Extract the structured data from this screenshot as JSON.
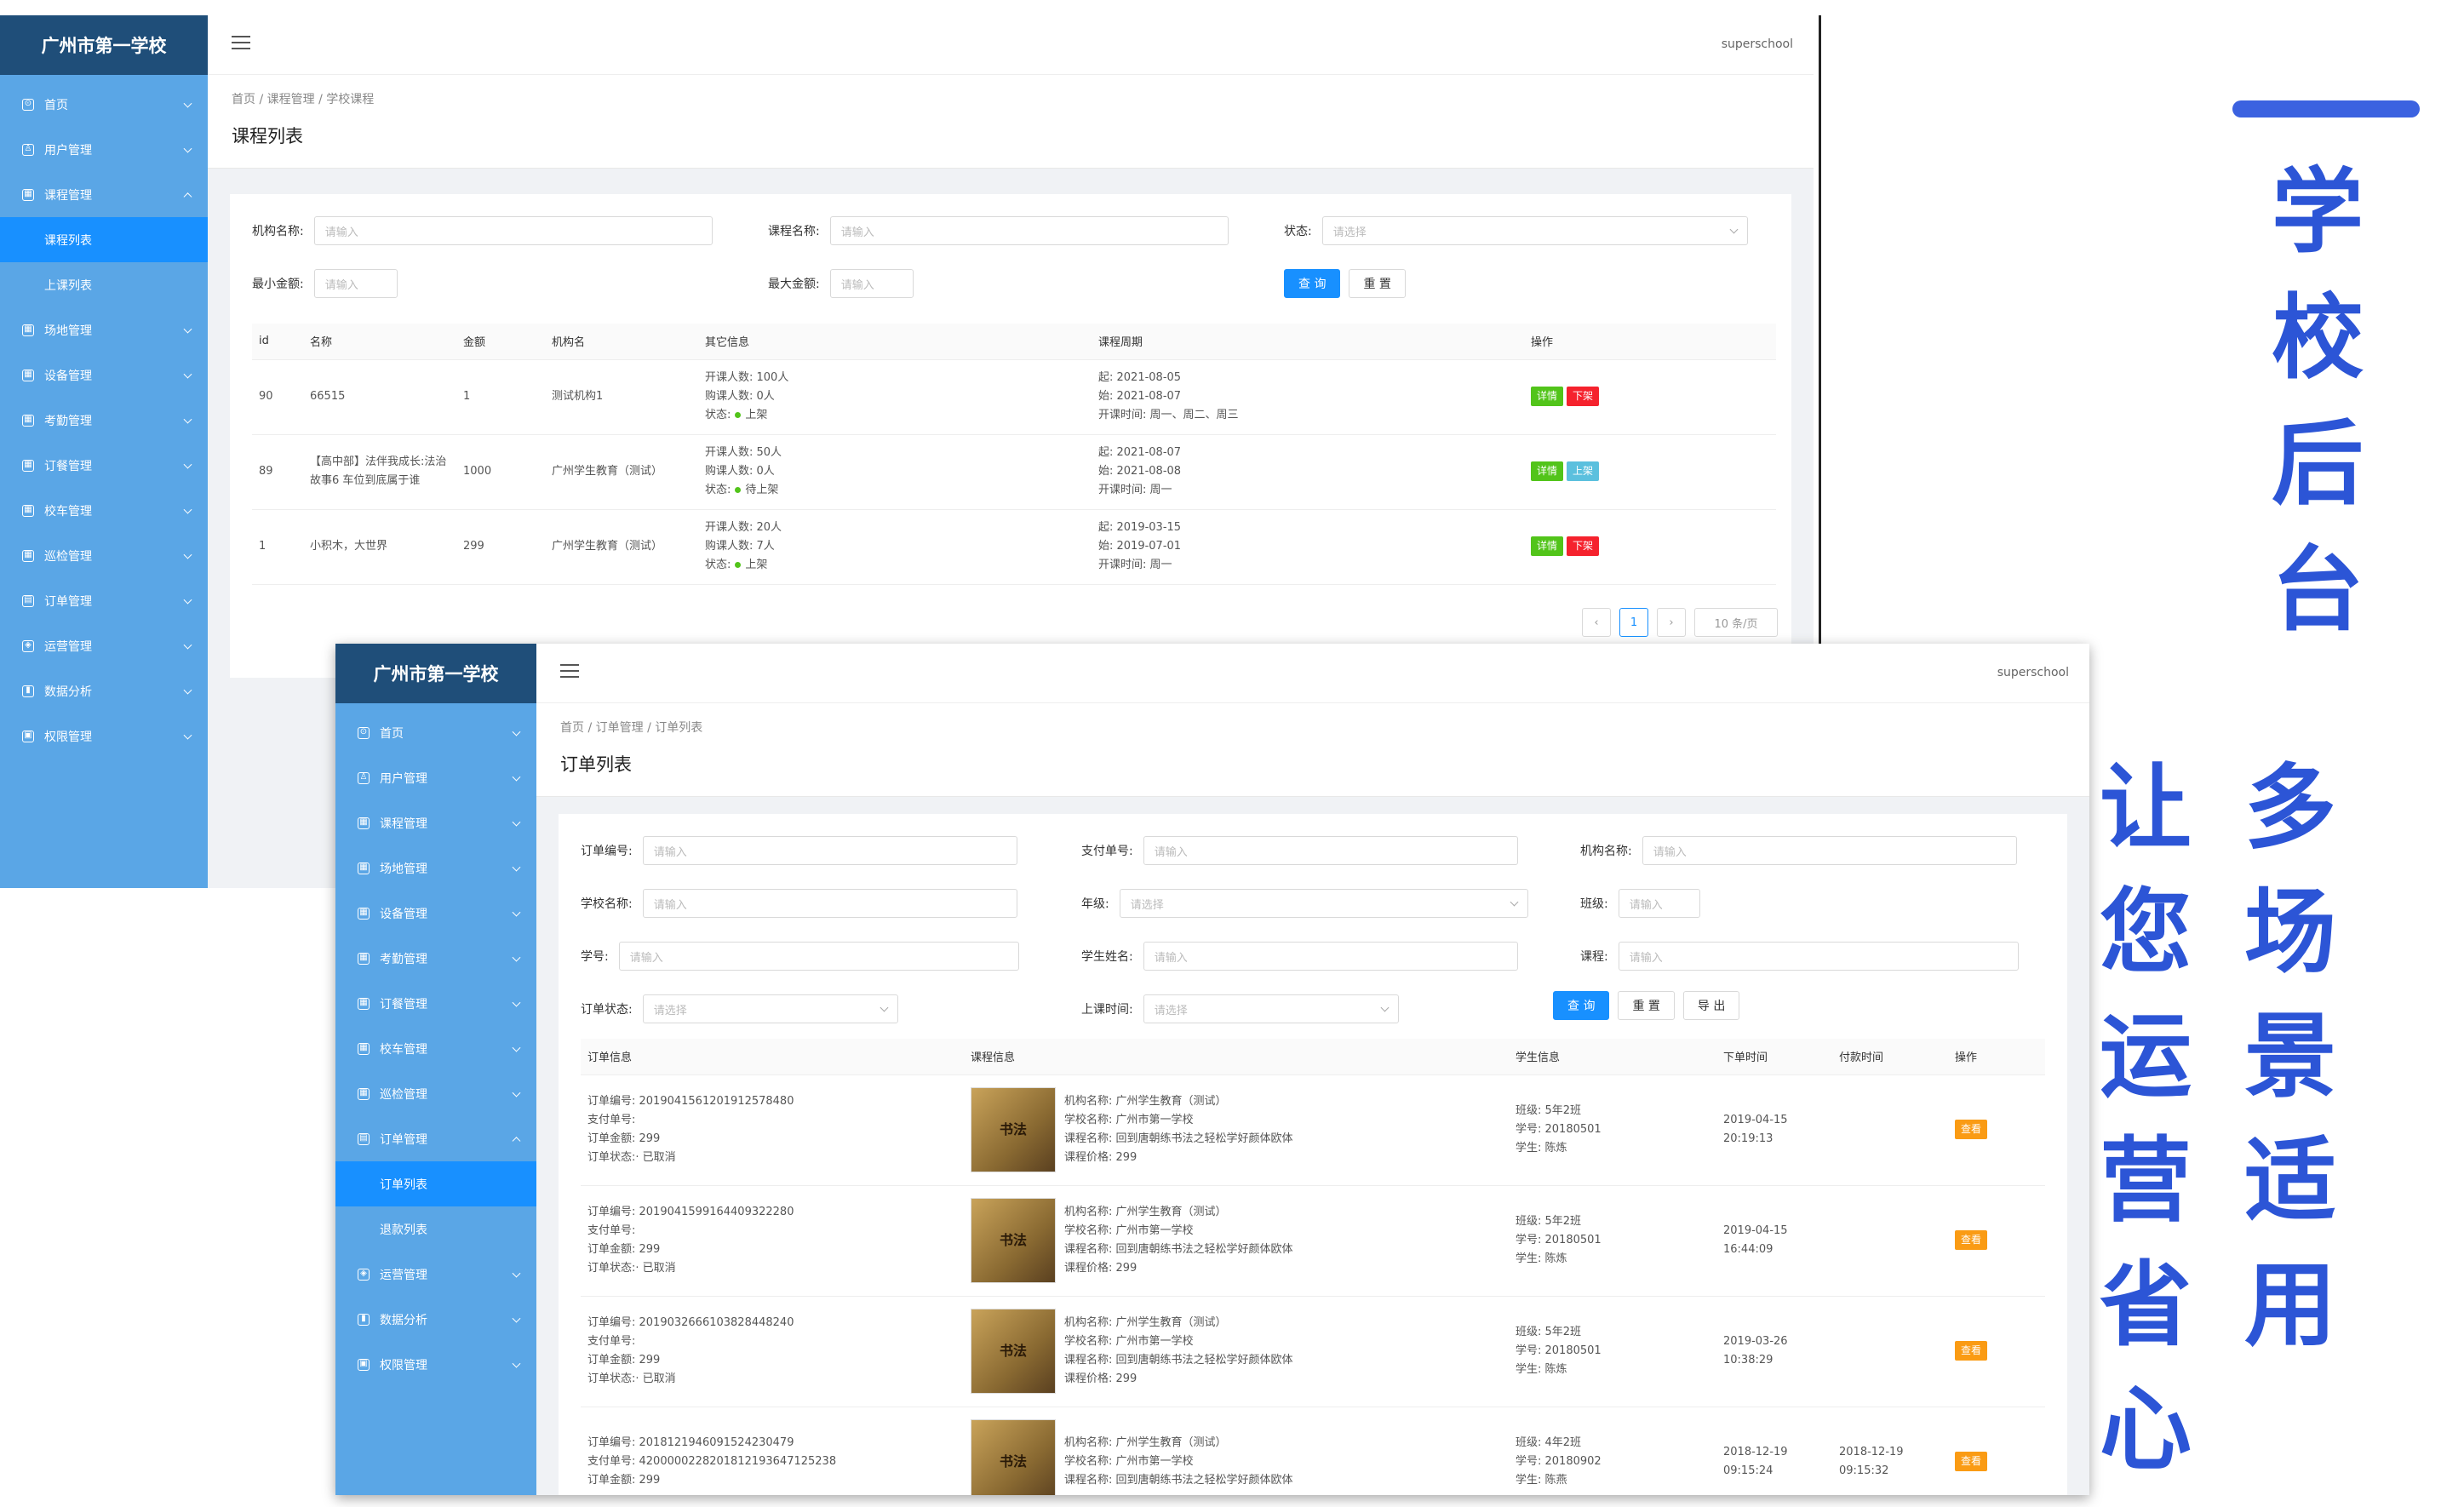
{
  "headline": {
    "main": [
      "学",
      "校",
      "后",
      "台"
    ],
    "col1": [
      "多",
      "场",
      "景",
      "适",
      "用"
    ],
    "col2": [
      "让",
      "您",
      "运",
      "营",
      "省",
      "心"
    ]
  },
  "app": {
    "school": "广州市第一学校",
    "user": "superschool"
  },
  "shot1": {
    "menu": [
      {
        "label": "首页",
        "icon": "⊙"
      },
      {
        "label": "用户管理",
        "icon": "♙"
      },
      {
        "label": "课程管理",
        "icon": "▦",
        "expanded": true
      },
      {
        "label": "场地管理",
        "icon": "▦"
      },
      {
        "label": "设备管理",
        "icon": "▦"
      },
      {
        "label": "考勤管理",
        "icon": "▦"
      },
      {
        "label": "订餐管理",
        "icon": "▦"
      },
      {
        "label": "校车管理",
        "icon": "▦"
      },
      {
        "label": "巡检管理",
        "icon": "▦"
      },
      {
        "label": "订单管理",
        "icon": "▤"
      },
      {
        "label": "运营管理",
        "icon": "◈"
      },
      {
        "label": "数据分析",
        "icon": "▮"
      },
      {
        "label": "权限管理",
        "icon": "▣"
      }
    ],
    "submenu": [
      "课程列表",
      "上课列表"
    ],
    "breadcrumb": "首页 / 课程管理 / 学校课程",
    "title": "课程列表",
    "filters": {
      "org_label": "机构名称:",
      "org_ph": "请输入",
      "course_label": "课程名称:",
      "course_ph": "请输入",
      "status_label": "状态:",
      "status_ph": "请选择",
      "min_label": "最小金额:",
      "min_ph": "请输入",
      "max_label": "最大金额:",
      "max_ph": "请输入",
      "query": "查 询",
      "reset": "重 置"
    },
    "columns": [
      "id",
      "名称",
      "金额",
      "机构名",
      "其它信息",
      "课程周期",
      "操作"
    ],
    "rows": [
      {
        "id": "90",
        "name": "66515",
        "amount": "1",
        "org": "测试机构1",
        "info": [
          "开课人数: 100人",
          "购课人数: 0人",
          "状态:"
        ],
        "status": "上架",
        "period": [
          "起: 2021-08-05",
          "始: 2021-08-07",
          "开课时间: 周一、周二、周三"
        ],
        "actions": [
          "详情",
          "下架"
        ]
      },
      {
        "id": "89",
        "name": "【高中部】法伴我成长:法治故事6 车位到底属于谁",
        "amount": "1000",
        "org": "广州学生教育（测试）",
        "info": [
          "开课人数: 50人",
          "购课人数: 0人",
          "状态:"
        ],
        "status": "待上架",
        "period": [
          "起: 2021-08-07",
          "始: 2021-08-08",
          "开课时间: 周一"
        ],
        "actions": [
          "详情",
          "上架"
        ]
      },
      {
        "id": "1",
        "name": "小积木，大世界",
        "amount": "299",
        "org": "广州学生教育（测试）",
        "info": [
          "开课人数: 20人",
          "购课人数: 7人",
          "状态:"
        ],
        "status": "上架",
        "period": [
          "起: 2019-03-15",
          "始: 2019-07-01",
          "开课时间: 周一"
        ],
        "actions": [
          "详情",
          "下架"
        ]
      }
    ],
    "pager": {
      "prev": "‹",
      "page": "1",
      "next": "›",
      "size": "10 条/页"
    }
  },
  "shot2": {
    "menu": [
      {
        "label": "首页",
        "icon": "⊙"
      },
      {
        "label": "用户管理",
        "icon": "♙"
      },
      {
        "label": "课程管理",
        "icon": "▦"
      },
      {
        "label": "场地管理",
        "icon": "▦"
      },
      {
        "label": "设备管理",
        "icon": "▦"
      },
      {
        "label": "考勤管理",
        "icon": "▦"
      },
      {
        "label": "订餐管理",
        "icon": "▦"
      },
      {
        "label": "校车管理",
        "icon": "▦"
      },
      {
        "label": "巡检管理",
        "icon": "▦"
      },
      {
        "label": "订单管理",
        "icon": "▤",
        "expanded": true
      }
    ],
    "submenu": [
      "订单列表",
      "退款列表"
    ],
    "menu_after": [
      {
        "label": "运营管理",
        "icon": "◈"
      },
      {
        "label": "数据分析",
        "icon": "▮"
      },
      {
        "label": "权限管理",
        "icon": "▣"
      }
    ],
    "breadcrumb": "首页 / 订单管理 / 订单列表",
    "title": "订单列表",
    "filters": {
      "order_no": "订单编号:",
      "pay_no": "支付单号:",
      "org": "机构名称:",
      "school": "学校名称:",
      "grade": "年级:",
      "clazz": "班级:",
      "student_no": "学号:",
      "student_name": "学生姓名:",
      "course": "课程:",
      "order_status": "订单状态:",
      "class_time": "上课时间:",
      "ph_input": "请输入",
      "ph_select": "请选择",
      "query": "查 询",
      "reset": "重 置",
      "export": "导 出"
    },
    "columns": [
      "订单信息",
      "课程信息",
      "学生信息",
      "下单时间",
      "付款时间",
      "操作"
    ],
    "orders": [
      {
        "info": [
          "订单编号: 201904156120191257848​0",
          "支付单号:",
          "订单金额: 299",
          "订单状态:· 已取消"
        ],
        "course": [
          "机构名称: 广州学生教育（测试）",
          "学校名称: 广州市第一学校",
          "课程名称: 回到唐朝练书法之轻松学好颜体欧体",
          "课程价格: 299"
        ],
        "student": [
          "班级: 5年2班",
          "学号: 20180501",
          "学生: 陈炼"
        ],
        "order_time": [
          "2019-04-15",
          "20:19:13"
        ],
        "pay_time": [
          "",
          ""
        ],
        "action": "查看"
      },
      {
        "info": [
          "订单编号: 20190415991644093222​80",
          "支付单号:",
          "订单金额: 299",
          "订单状态:· 已取消"
        ],
        "course": [
          "机构名称: 广州学生教育（测试）",
          "学校名称: 广州市第一学校",
          "课程名称: 回到唐朝练书法之轻松学好颜体欧体",
          "课程价格: 299"
        ],
        "student": [
          "班级: 5年2班",
          "学号: 20180501",
          "学生: 陈炼"
        ],
        "order_time": [
          "2019-04-15",
          "16:44:09"
        ],
        "pay_time": [
          "",
          ""
        ],
        "action": "查看"
      },
      {
        "info": [
          "订单编号: 201903266610382844824​0",
          "支付单号:",
          "订单金额: 299",
          "订单状态:· 已取消"
        ],
        "course": [
          "机构名称: 广州学生教育（测试）",
          "学校名称: 广州市第一学校",
          "课程名称: 回到唐朝练书法之轻松学好颜体欧体",
          "课程价格: 299"
        ],
        "student": [
          "班级: 5年2班",
          "学号: 20180501",
          "学生: 陈炼"
        ],
        "order_time": [
          "2019-03-26",
          "10:38:29"
        ],
        "pay_time": [
          "",
          ""
        ],
        "action": "查看"
      },
      {
        "info": [
          "订单编号: 201812194609152423047​9",
          "支付单号: 42000002282018121936471​25238",
          "订单金额: 299"
        ],
        "course": [
          "机构名称: 广州学生教育（测试）",
          "学校名称: 广州市第一学校",
          "课程名称: 回到唐朝练书法之轻松学好颜体欧体"
        ],
        "student": [
          "班级: 4年2班",
          "学号: 20180902",
          "学生: 陈燕"
        ],
        "order_time": [
          "2018-12-19",
          "09:15:24"
        ],
        "pay_time": [
          "2018-12-19",
          "09:15:32"
        ],
        "action": "查看"
      }
    ],
    "thumb_text": "书法"
  }
}
